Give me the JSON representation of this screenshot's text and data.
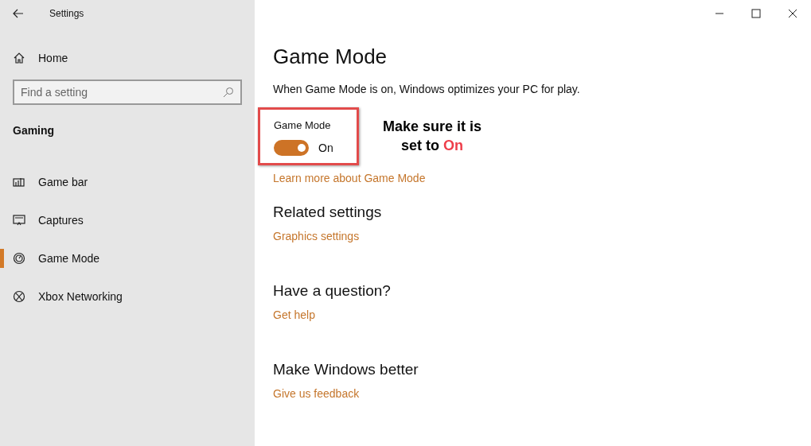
{
  "window": {
    "title": "Settings"
  },
  "sidebar": {
    "home": "Home",
    "search": {
      "placeholder": "Find a setting"
    },
    "section": "Gaming",
    "items": [
      {
        "label": "Game bar",
        "selected": false
      },
      {
        "label": "Captures",
        "selected": false
      },
      {
        "label": "Game Mode",
        "selected": true
      },
      {
        "label": "Xbox Networking",
        "selected": false
      }
    ]
  },
  "main": {
    "title": "Game Mode",
    "description": "When Game Mode is on, Windows optimizes your PC for play.",
    "toggle": {
      "label": "Game Mode",
      "on": true,
      "state_text": "On"
    },
    "annotation": {
      "text": "Make sure it is set to",
      "highlight": "On"
    },
    "learn_more": "Learn more about Game Mode",
    "sections": [
      {
        "heading": "Related settings",
        "link": "Graphics settings"
      },
      {
        "heading": "Have a question?",
        "link": "Get help"
      },
      {
        "heading": "Make Windows better",
        "link": "Give us feedback"
      }
    ]
  }
}
